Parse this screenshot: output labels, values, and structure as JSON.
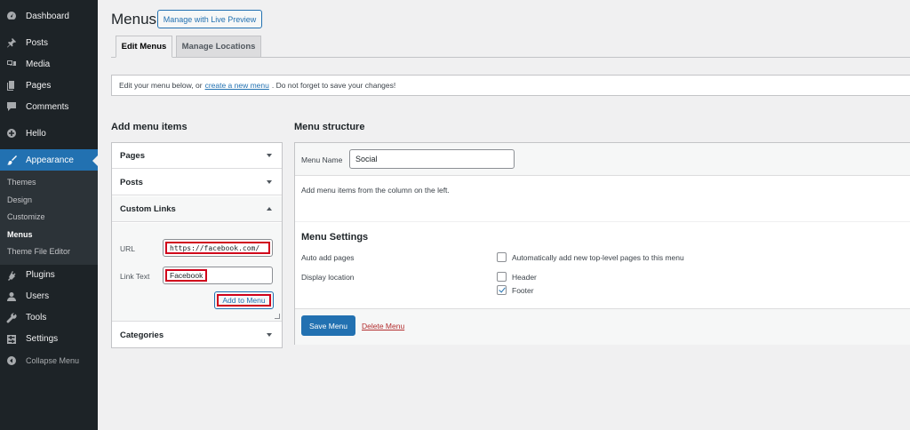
{
  "sidebar": {
    "items": [
      {
        "label": "Dashboard",
        "icon": "dashboard-icon"
      },
      {
        "label": "Posts",
        "icon": "pin-icon"
      },
      {
        "label": "Media",
        "icon": "media-icon"
      },
      {
        "label": "Pages",
        "icon": "pages-icon"
      },
      {
        "label": "Comments",
        "icon": "comment-icon"
      },
      {
        "label": "Hello",
        "icon": "plus-circle-icon"
      },
      {
        "label": "Appearance",
        "icon": "brush-icon"
      },
      {
        "label": "Plugins",
        "icon": "plug-icon"
      },
      {
        "label": "Users",
        "icon": "user-icon"
      },
      {
        "label": "Tools",
        "icon": "wrench-icon"
      },
      {
        "label": "Settings",
        "icon": "settings-icon"
      },
      {
        "label": "Collapse Menu",
        "icon": "collapse-icon"
      }
    ],
    "submenu": [
      "Themes",
      "Design",
      "Customize",
      "Menus",
      "Theme File Editor"
    ]
  },
  "header": {
    "title": "Menus",
    "live_preview": "Manage with Live Preview"
  },
  "tabs": [
    "Edit Menus",
    "Manage Locations"
  ],
  "notice": {
    "before": "Edit your menu below, or",
    "link": "create a new menu",
    "after": ". Do not forget to save your changes!"
  },
  "add_items": {
    "title": "Add menu items",
    "sections": [
      "Pages",
      "Posts",
      "Custom Links",
      "Categories"
    ],
    "url_label": "URL",
    "url_value": "https://facebook.com/",
    "link_text_label": "Link Text",
    "link_text_value": "Facebook",
    "add_button": "Add to Menu"
  },
  "structure": {
    "title": "Menu structure",
    "menu_name_label": "Menu Name",
    "menu_name_value": "Social",
    "hint": "Add menu items from the column on the left.",
    "settings_title": "Menu Settings",
    "auto_add_label": "Auto add pages",
    "auto_add_option": "Automatically add new top-level pages to this menu",
    "display_location_label": "Display location",
    "locations": [
      "Header",
      "Footer"
    ],
    "save_button": "Save Menu",
    "delete_link": "Delete Menu"
  },
  "colors": {
    "accent": "#2271b1",
    "sidebar": "#1d2327",
    "highlight": "#d0021b",
    "danger": "#b32d2e"
  }
}
